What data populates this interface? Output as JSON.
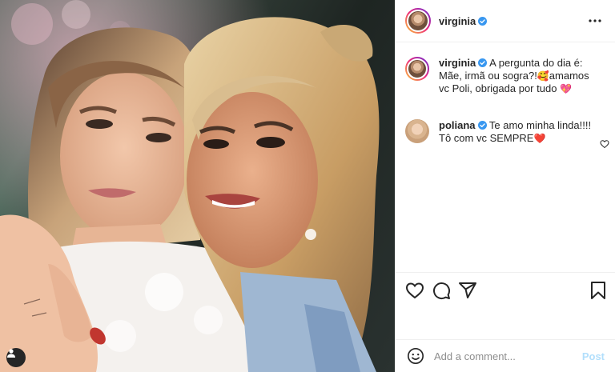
{
  "colors": {
    "verified": "#3897f0",
    "text": "#262626",
    "muted": "#8e8e8e",
    "post_disabled": "#b2dffc",
    "heart_emoji": "#e0245e",
    "pink_heart_emoji": "#ff6fb1"
  },
  "header": {
    "username": "virginia",
    "verified_icon": "verified-badge-icon",
    "more_icon": "more-options-icon"
  },
  "caption": {
    "username": "virginia",
    "text_part1": "A pergunta do dia é: Mãe, irmã ou sogra?!",
    "emoji1": "🥰",
    "text_part2": "amamos vc Poli, obrigada por tudo",
    "emoji2": "💖"
  },
  "comments": [
    {
      "username": "poliana",
      "text": "Te amo minha linda!!!! Tô com vc SEMPRE",
      "emoji": "❤️"
    }
  ],
  "actions": {
    "like_icon": "heart-icon",
    "comment_icon": "comment-icon",
    "share_icon": "share-icon",
    "save_icon": "bookmark-icon"
  },
  "comment_box": {
    "emoji_icon": "emoji-icon",
    "placeholder": "Add a comment...",
    "post_label": "Post"
  },
  "media": {
    "user_tag_icon": "user-tag-icon"
  }
}
